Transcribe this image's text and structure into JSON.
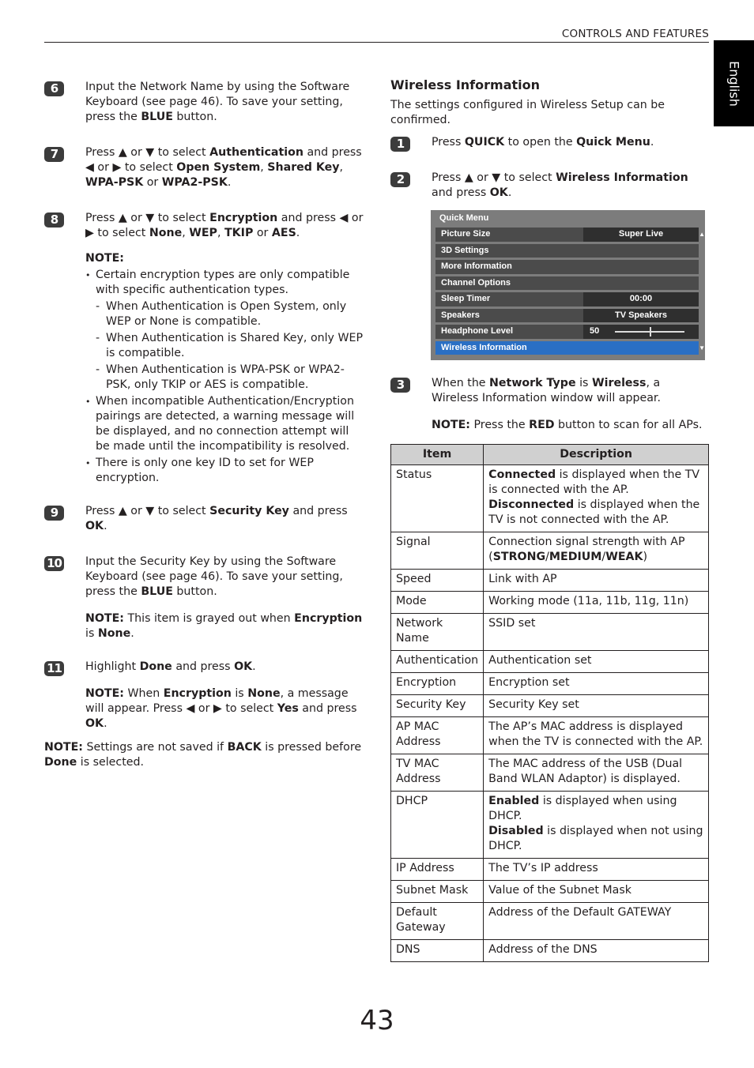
{
  "header": {
    "section_title": "CONTROLS AND FEATURES",
    "language_tab": "English"
  },
  "left_column": {
    "steps": [
      {
        "number": "6",
        "runs": [
          {
            "t": "Input the Network Name by using the Software Keyboard (see page 46). To save your setting, press the "
          },
          {
            "t": "BLUE",
            "b": true
          },
          {
            "t": " button."
          }
        ]
      },
      {
        "number": "7",
        "runs": [
          {
            "t": "Press ▲ or ▼ to select "
          },
          {
            "t": "Authentication",
            "b": true
          },
          {
            "t": " and press ◀ or ▶ to select "
          },
          {
            "t": "Open System",
            "b": true
          },
          {
            "t": ", "
          },
          {
            "t": "Shared Key",
            "b": true
          },
          {
            "t": ", "
          },
          {
            "t": "WPA-PSK",
            "b": true
          },
          {
            "t": " or "
          },
          {
            "t": "WPA2-PSK",
            "b": true
          },
          {
            "t": "."
          }
        ]
      },
      {
        "number": "8",
        "runs": [
          {
            "t": "Press ▲ or ▼ to select "
          },
          {
            "t": "Encryption",
            "b": true
          },
          {
            "t": " and press ◀ or ▶ to select "
          },
          {
            "t": "None",
            "b": true
          },
          {
            "t": ", "
          },
          {
            "t": "WEP",
            "b": true
          },
          {
            "t": ", "
          },
          {
            "t": "TKIP",
            "b": true
          },
          {
            "t": " or "
          },
          {
            "t": "AES",
            "b": true
          },
          {
            "t": "."
          }
        ]
      }
    ],
    "note8": {
      "label": "NOTE:",
      "items": [
        {
          "type": "bullet",
          "text": "Certain encryption types are only compatible with specific authentication types."
        },
        {
          "type": "dash",
          "text": "When Authentication is Open System, only WEP or None is compatible."
        },
        {
          "type": "dash",
          "text": "When Authentication is Shared Key, only WEP is compatible."
        },
        {
          "type": "dash",
          "text": "When Authentication is WPA-PSK or WPA2-PSK, only TKIP or AES is compatible."
        },
        {
          "type": "bullet",
          "text": "When incompatible Authentication/Encryption pairings are detected, a warning message will be displayed, and no connection attempt will be made until the incompatibility is resolved."
        },
        {
          "type": "bullet",
          "text": "There is only one key ID to set for WEP encryption."
        }
      ]
    },
    "steps2": [
      {
        "number": "9",
        "runs": [
          {
            "t": "Press ▲ or ▼ to select "
          },
          {
            "t": "Security Key",
            "b": true
          },
          {
            "t": " and press "
          },
          {
            "t": "OK",
            "b": true
          },
          {
            "t": "."
          }
        ]
      },
      {
        "number": "10",
        "runs": [
          {
            "t": "Input the Security Key by using the Software Keyboard (see page 46). To save your setting, press the "
          },
          {
            "t": "BLUE",
            "b": true
          },
          {
            "t": " button."
          }
        ]
      },
      {
        "number": "11",
        "runs": [
          {
            "t": "Highlight "
          },
          {
            "t": "Done",
            "b": true
          },
          {
            "t": " and press "
          },
          {
            "t": "OK",
            "b": true
          },
          {
            "t": "."
          }
        ]
      }
    ],
    "note10": [
      {
        "t": "NOTE:",
        "b": true
      },
      {
        "t": " This item is grayed out when "
      },
      {
        "t": "Encryption",
        "b": true
      },
      {
        "t": " is "
      },
      {
        "t": "None",
        "b": true
      },
      {
        "t": "."
      }
    ],
    "note11": [
      {
        "t": "NOTE:",
        "b": true
      },
      {
        "t": " When "
      },
      {
        "t": "Encryption",
        "b": true
      },
      {
        "t": " is "
      },
      {
        "t": "None",
        "b": true
      },
      {
        "t": ", a message will appear. Press ◀ or ▶ to select "
      },
      {
        "t": "Yes",
        "b": true
      },
      {
        "t": " and press "
      },
      {
        "t": "OK",
        "b": true
      },
      {
        "t": "."
      }
    ],
    "final_note": [
      {
        "t": "NOTE:",
        "b": true
      },
      {
        "t": " Settings are not saved if "
      },
      {
        "t": "BACK",
        "b": true
      },
      {
        "t": " is pressed before "
      },
      {
        "t": "Done",
        "b": true
      },
      {
        "t": " is selected."
      }
    ]
  },
  "right_column": {
    "title": "Wireless Information",
    "intro": "The settings configured in Wireless Setup can be confirmed.",
    "steps": [
      {
        "number": "1",
        "runs": [
          {
            "t": "Press "
          },
          {
            "t": "QUICK",
            "b": true
          },
          {
            "t": " to open the "
          },
          {
            "t": "Quick Menu",
            "b": true
          },
          {
            "t": "."
          }
        ]
      },
      {
        "number": "2",
        "runs": [
          {
            "t": "Press ▲ or ▼ to select "
          },
          {
            "t": "Wireless Information",
            "b": true
          },
          {
            "t": " and press "
          },
          {
            "t": "OK",
            "b": true
          },
          {
            "t": "."
          }
        ]
      }
    ],
    "quick_menu": {
      "title": "Quick Menu",
      "items": [
        {
          "label": "Picture Size",
          "value": "Super Live"
        },
        {
          "label": "3D Settings",
          "value": null
        },
        {
          "label": "More Information",
          "value": null
        },
        {
          "label": "Channel Options",
          "value": null
        },
        {
          "label": "Sleep Timer",
          "value": "00:00"
        },
        {
          "label": "Speakers",
          "value": "TV Speakers"
        },
        {
          "label": "Headphone Level",
          "value": "50",
          "slider_fraction": 0.5
        },
        {
          "label": "Wireless Information",
          "value": null,
          "selected": true
        }
      ],
      "scroll_up": "▲",
      "scroll_down": "▼"
    },
    "step3": {
      "number": "3",
      "runs": [
        {
          "t": "When the "
        },
        {
          "t": "Network Type",
          "b": true
        },
        {
          "t": " is "
        },
        {
          "t": "Wireless",
          "b": true
        },
        {
          "t": ", a Wireless Information window will appear."
        }
      ]
    },
    "step3_note": [
      {
        "t": "NOTE:",
        "b": true
      },
      {
        "t": " Press the "
      },
      {
        "t": "RED",
        "b": true
      },
      {
        "t": " button to scan for all APs."
      }
    ],
    "table": {
      "headers": [
        "Item",
        "Description"
      ],
      "rows": [
        {
          "item": "Status",
          "desc": [
            {
              "t": "Connected",
              "b": true
            },
            {
              "t": " is displayed when the TV is connected with the AP."
            },
            {
              "br": true
            },
            {
              "t": "Disconnected",
              "b": true
            },
            {
              "t": " is displayed when the TV is not connected with the AP."
            }
          ]
        },
        {
          "item": "Signal",
          "desc": [
            {
              "t": "Connection signal strength with AP ("
            },
            {
              "t": "STRONG",
              "b": true
            },
            {
              "t": "/"
            },
            {
              "t": "MEDIUM",
              "b": true
            },
            {
              "t": "/"
            },
            {
              "t": "WEAK",
              "b": true
            },
            {
              "t": ")"
            }
          ]
        },
        {
          "item": "Speed",
          "desc": [
            {
              "t": "Link with AP"
            }
          ]
        },
        {
          "item": "Mode",
          "desc": [
            {
              "t": "Working mode (11a, 11b, 11g, 11n)"
            }
          ]
        },
        {
          "item": "Network Name",
          "desc": [
            {
              "t": "SSID set"
            }
          ]
        },
        {
          "item": "Authentication",
          "desc": [
            {
              "t": "Authentication set"
            }
          ]
        },
        {
          "item": "Encryption",
          "desc": [
            {
              "t": "Encryption set"
            }
          ]
        },
        {
          "item": "Security Key",
          "desc": [
            {
              "t": "Security Key set"
            }
          ]
        },
        {
          "item": "AP MAC Address",
          "desc": [
            {
              "t": "The AP’s MAC address is displayed when the TV is connected with the AP."
            }
          ]
        },
        {
          "item": "TV MAC Address",
          "desc": [
            {
              "t": "The MAC address of the USB (Dual Band WLAN Adaptor) is displayed."
            }
          ]
        },
        {
          "item": "DHCP",
          "desc": [
            {
              "t": "Enabled",
              "b": true
            },
            {
              "t": " is displayed when using DHCP."
            },
            {
              "br": true
            },
            {
              "t": "Disabled",
              "b": true
            },
            {
              "t": " is displayed when not using DHCP."
            }
          ]
        },
        {
          "item": "IP Address",
          "desc": [
            {
              "t": "The TV’s IP address"
            }
          ]
        },
        {
          "item": "Subnet Mask",
          "desc": [
            {
              "t": "Value of the Subnet Mask"
            }
          ]
        },
        {
          "item": "Default Gateway",
          "desc": [
            {
              "t": "Address of the Default GATEWAY"
            }
          ]
        },
        {
          "item": "DNS",
          "desc": [
            {
              "t": "Address of the DNS"
            }
          ]
        }
      ]
    }
  },
  "footer": {
    "page_number": "43"
  }
}
